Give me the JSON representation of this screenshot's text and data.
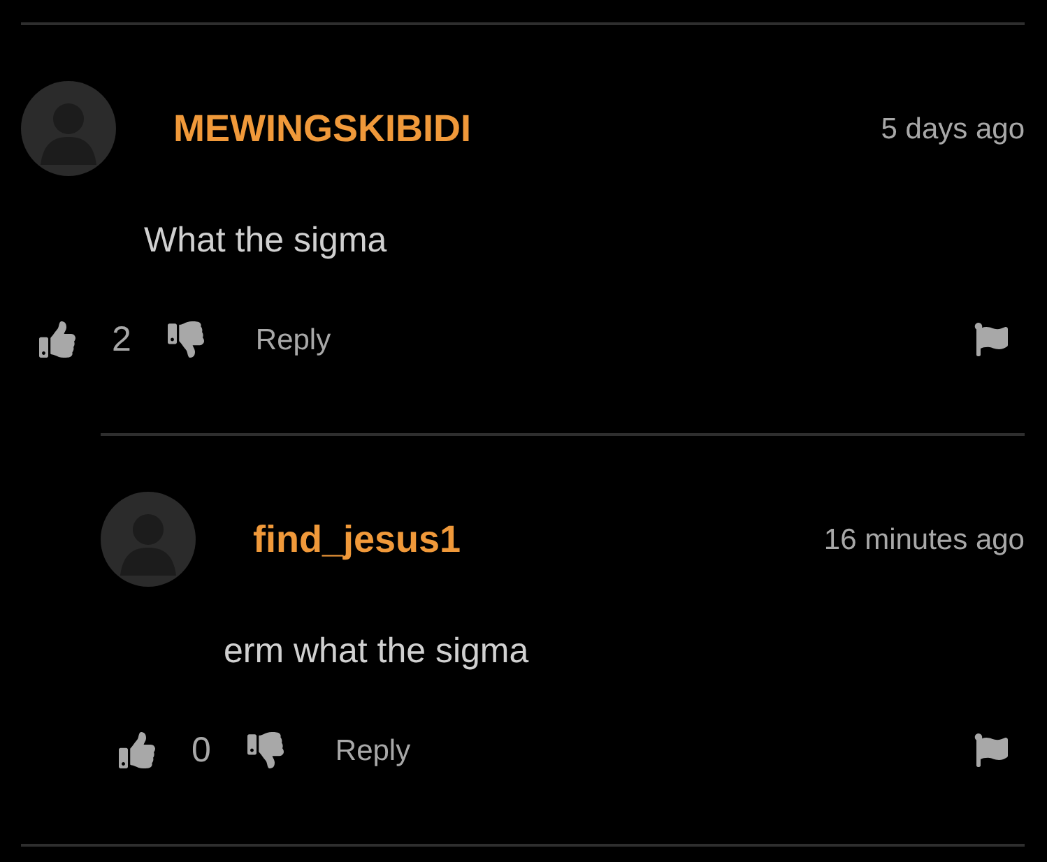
{
  "comments": [
    {
      "author": "MEWINGSKIBIDI",
      "time": "5 days ago",
      "text": "What the sigma",
      "likes": "2",
      "reply_label": "Reply",
      "replies": [
        {
          "author": "find_jesus1",
          "time": "16 minutes ago",
          "text": "erm what the sigma",
          "likes": "0",
          "reply_label": "Reply"
        }
      ]
    }
  ]
}
